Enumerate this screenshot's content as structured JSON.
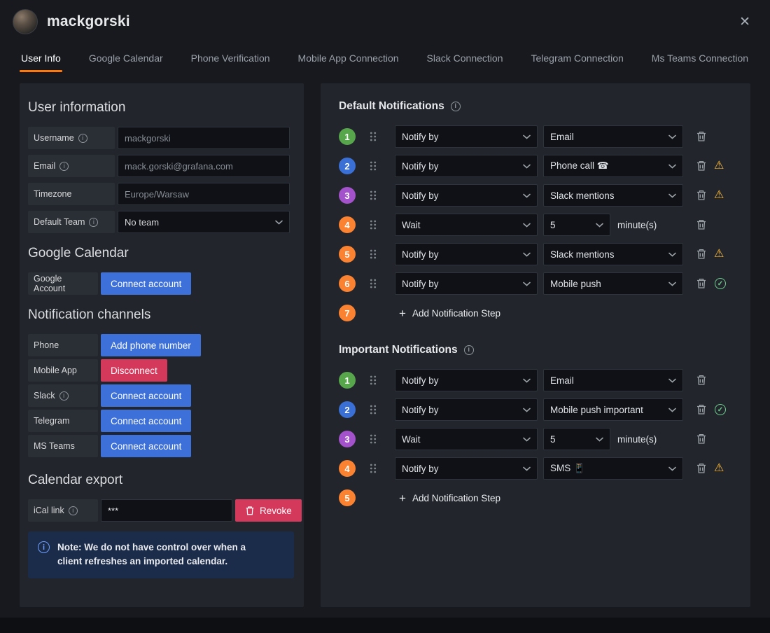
{
  "colors": {
    "accent_orange": "#ff780a",
    "primary_button": "#3d71d9",
    "danger_button": "#d4395c",
    "warning": "#f8b437",
    "ok": "#6ccf8e",
    "badge_green": "#57a64b",
    "badge_blue": "#3a70d6",
    "badge_purple": "#a352cc",
    "badge_orange": "#fa8231"
  },
  "icons": {
    "close": "✕",
    "info": "i",
    "plus": "+",
    "warning": "⚠",
    "check": "✓"
  },
  "header": {
    "title": "mackgorski"
  },
  "tabs": [
    {
      "label": "User Info",
      "active": true
    },
    {
      "label": "Google Calendar",
      "active": false
    },
    {
      "label": "Phone Verification",
      "active": false
    },
    {
      "label": "Mobile App Connection",
      "active": false
    },
    {
      "label": "Slack Connection",
      "active": false
    },
    {
      "label": "Telegram Connection",
      "active": false
    },
    {
      "label": "Ms Teams Connection",
      "active": false
    }
  ],
  "user_info": {
    "heading": "User information",
    "fields": [
      {
        "label": "Username",
        "value": "mackgorski"
      },
      {
        "label": "Email",
        "value": "mack.gorski@grafana.com"
      },
      {
        "label": "Timezone",
        "value": "Europe/Warsaw"
      },
      {
        "label": "Default Team",
        "value": "No team"
      }
    ]
  },
  "google_calendar": {
    "heading": "Google Calendar",
    "account_label": "Google Account",
    "connect_button": "Connect account"
  },
  "notification_channels": {
    "heading": "Notification channels",
    "rows": [
      {
        "label": "Phone",
        "button": "Add phone number"
      },
      {
        "label": "Mobile App",
        "button": "Disconnect"
      },
      {
        "label": "Slack",
        "button": "Connect account"
      },
      {
        "label": "Telegram",
        "button": "Connect account"
      },
      {
        "label": "MS Teams",
        "button": "Connect account"
      }
    ]
  },
  "calendar_export": {
    "heading": "Calendar export",
    "ical_label": "iCal link",
    "ical_value": "***",
    "revoke_button": "Revoke",
    "note": "Note: We do not have control over when a client refreshes an imported calendar."
  },
  "default_notifications": {
    "heading": "Default Notifications",
    "steps": [
      {
        "num": "1",
        "color": "#57a64b",
        "action": "Notify by",
        "value": "Email",
        "status": "none"
      },
      {
        "num": "2",
        "color": "#3a70d6",
        "action": "Notify by",
        "value": "Phone call ☎",
        "status": "warning"
      },
      {
        "num": "3",
        "color": "#a352cc",
        "action": "Notify by",
        "value": "Slack mentions",
        "status": "warning"
      },
      {
        "num": "4",
        "color": "#fa8231",
        "action": "Wait",
        "value": "5",
        "unit": "minute(s)",
        "status": "none"
      },
      {
        "num": "5",
        "color": "#fa8231",
        "action": "Notify by",
        "value": "Slack mentions",
        "status": "warning"
      },
      {
        "num": "6",
        "color": "#fa8231",
        "action": "Notify by",
        "value": "Mobile push",
        "status": "ok"
      }
    ],
    "add_step": {
      "num": "7",
      "color": "#fa8231",
      "label": "Add Notification Step"
    }
  },
  "important_notifications": {
    "heading": "Important Notifications",
    "steps": [
      {
        "num": "1",
        "color": "#57a64b",
        "action": "Notify by",
        "value": "Email",
        "status": "none"
      },
      {
        "num": "2",
        "color": "#3a70d6",
        "action": "Notify by",
        "value": "Mobile push important",
        "status": "ok"
      },
      {
        "num": "3",
        "color": "#a352cc",
        "action": "Wait",
        "value": "5",
        "unit": "minute(s)",
        "status": "none"
      },
      {
        "num": "4",
        "color": "#fa8231",
        "action": "Notify by",
        "value": "SMS 📱",
        "status": "warning"
      }
    ],
    "add_step": {
      "num": "5",
      "color": "#fa8231",
      "label": "Add Notification Step"
    }
  }
}
